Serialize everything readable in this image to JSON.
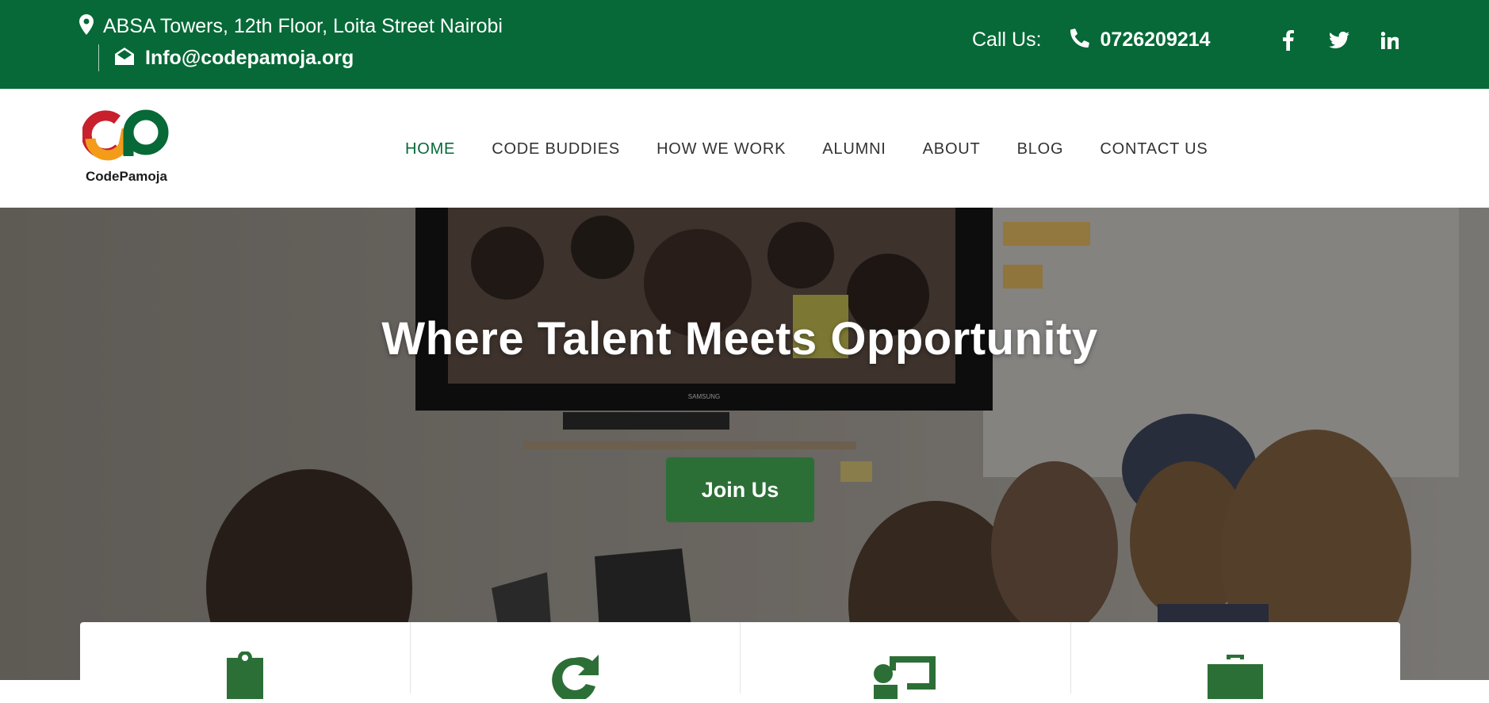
{
  "topbar": {
    "address": "ABSA Towers, 12th Floor, Loita Street Nairobi",
    "email": "Info@codepamoja.org",
    "call_label": "Call Us:",
    "phone": "0726209214",
    "social": [
      "facebook-icon",
      "twitter-icon",
      "linkedin-icon"
    ],
    "bg_color": "#066937"
  },
  "logo": {
    "wordmark": "CodePamoja"
  },
  "nav": {
    "items": [
      {
        "label": "HOME",
        "active": true
      },
      {
        "label": "CODE BUDDIES"
      },
      {
        "label": "HOW WE WORK"
      },
      {
        "label": "ALUMNI"
      },
      {
        "label": "ABOUT"
      },
      {
        "label": "BLOG"
      },
      {
        "label": "CONTACT US"
      }
    ],
    "active_color": "#066937"
  },
  "hero": {
    "title": "Where Talent Meets Opportunity",
    "button_label": "Join Us",
    "tv_brand": "SAMSUNG",
    "button_color": "#2c6f36"
  },
  "features": {
    "icons": [
      "clipboard-icon",
      "redo-icon",
      "chalkboard-teacher-icon",
      "briefcase-icon"
    ]
  }
}
